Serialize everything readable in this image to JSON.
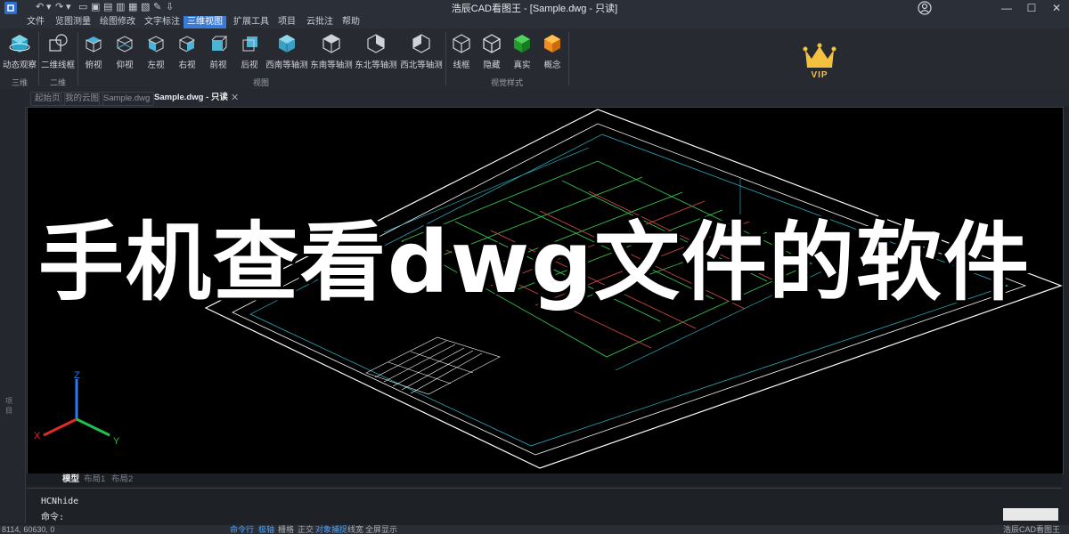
{
  "titlebar": {
    "title": "浩辰CAD看图王 - [Sample.dwg - 只读]",
    "minimize": "—",
    "maximize": "☐",
    "close": "✕"
  },
  "menu": [
    "文件",
    "览图测量",
    "绘图修改",
    "文字标注",
    "三维视图",
    "扩展工具",
    "项目",
    "云批注",
    "帮助"
  ],
  "menu_active_index": 4,
  "ribbon": {
    "buttons": [
      {
        "label": "动态观察"
      },
      {
        "label": "二维线框"
      },
      {
        "label": "俯视"
      },
      {
        "label": "仰视"
      },
      {
        "label": "左视"
      },
      {
        "label": "右视"
      },
      {
        "label": "前视"
      },
      {
        "label": "后视"
      },
      {
        "label": "西南等轴测"
      },
      {
        "label": "东南等轴测"
      },
      {
        "label": "东北等轴测"
      },
      {
        "label": "西北等轴测"
      },
      {
        "label": "线框"
      },
      {
        "label": "隐藏"
      },
      {
        "label": "真实"
      },
      {
        "label": "概念"
      }
    ],
    "groups": [
      "三维",
      "二维",
      "视图",
      "视觉样式"
    ],
    "vip": "VIP"
  },
  "side_tab": "项目",
  "doc_tabs": [
    "起始页",
    "我的云图",
    "Sample.dwg",
    "Sample.dwg - 只读"
  ],
  "doc_tab_close": "✕",
  "headline": "手机查看dwg文件的软件",
  "ucs": {
    "x": "X",
    "y": "Y",
    "z": "Z"
  },
  "layout_tabs": [
    "模型",
    "布局1",
    "布局2"
  ],
  "command": {
    "history": "HCNhide",
    "prompt": "命令:"
  },
  "status": {
    "coords": "8114, 60630, 0",
    "toggles": [
      {
        "label": "命令行",
        "on": true
      },
      {
        "label": "极轴",
        "on": true
      },
      {
        "label": "栅格",
        "on": false
      },
      {
        "label": "正交",
        "on": false
      },
      {
        "label": "对象捕捉",
        "on": true
      },
      {
        "label": "线宽",
        "on": false
      },
      {
        "label": "全屏显示",
        "on": false
      }
    ],
    "app_name": "浩辰CAD看图王"
  },
  "colors": {
    "accent": "#3a7bd5",
    "drawing_green": "#39d353",
    "drawing_red": "#e04848",
    "drawing_cyan": "#2bc3d6"
  }
}
